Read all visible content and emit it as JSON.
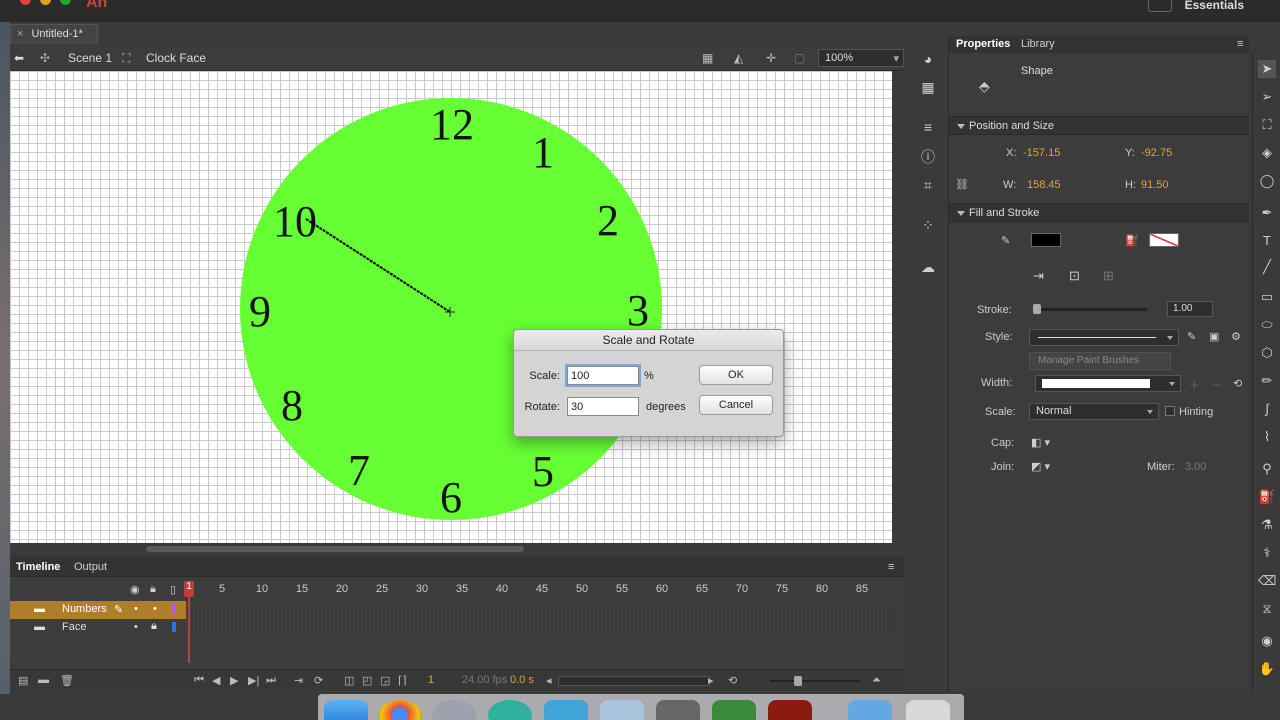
{
  "app": {
    "logo": "An",
    "workspace": "Essentials"
  },
  "document": {
    "tab_title": "Untitled-1*",
    "close_symbol": "×"
  },
  "edit_bar": {
    "scene": "Scene 1",
    "symbol": "Clock Face",
    "zoom": "100%"
  },
  "stage": {
    "clock_numbers": [
      "12",
      "1",
      "2",
      "3",
      "5",
      "6",
      "7",
      "8",
      "9",
      "10"
    ],
    "face_color": "#66ff33"
  },
  "dialog": {
    "title": "Scale and Rotate",
    "scale_label": "Scale:",
    "scale_value": "100",
    "scale_unit": "%",
    "rotate_label": "Rotate:",
    "rotate_value": "30",
    "rotate_unit": "degrees",
    "ok_label": "OK",
    "cancel_label": "Cancel"
  },
  "properties": {
    "tabs": [
      "Properties",
      "Library"
    ],
    "object_type": "Shape",
    "position_size": {
      "header": "Position and Size",
      "x_label": "X:",
      "x_value": "-157.15",
      "y_label": "Y:",
      "y_value": "-92.75",
      "w_label": "W:",
      "w_value": "158.45",
      "h_label": "H:",
      "h_value": "91.50"
    },
    "fill_stroke": {
      "header": "Fill and Stroke",
      "stroke_color": "#000000",
      "stroke_label": "Stroke:",
      "stroke_value": "1.00",
      "style_label": "Style:",
      "manage_brushes": "Manage Paint Brushes",
      "width_label": "Width:",
      "scale_label": "Scale:",
      "scale_value": "Normal",
      "hinting_label": "Hinting",
      "cap_label": "Cap:",
      "join_label": "Join:",
      "miter_label": "Miter:",
      "miter_value": "3.00"
    }
  },
  "timeline": {
    "tabs": [
      "Timeline",
      "Output"
    ],
    "ruler": [
      "1",
      "5",
      "10",
      "15",
      "20",
      "25",
      "30",
      "35",
      "40",
      "45",
      "50",
      "55",
      "60",
      "65",
      "70",
      "75",
      "80",
      "85"
    ],
    "layers": [
      "Numbers",
      "Face"
    ],
    "current_frame": "1",
    "fps": "24.00 fps",
    "time": "0.0 s"
  }
}
